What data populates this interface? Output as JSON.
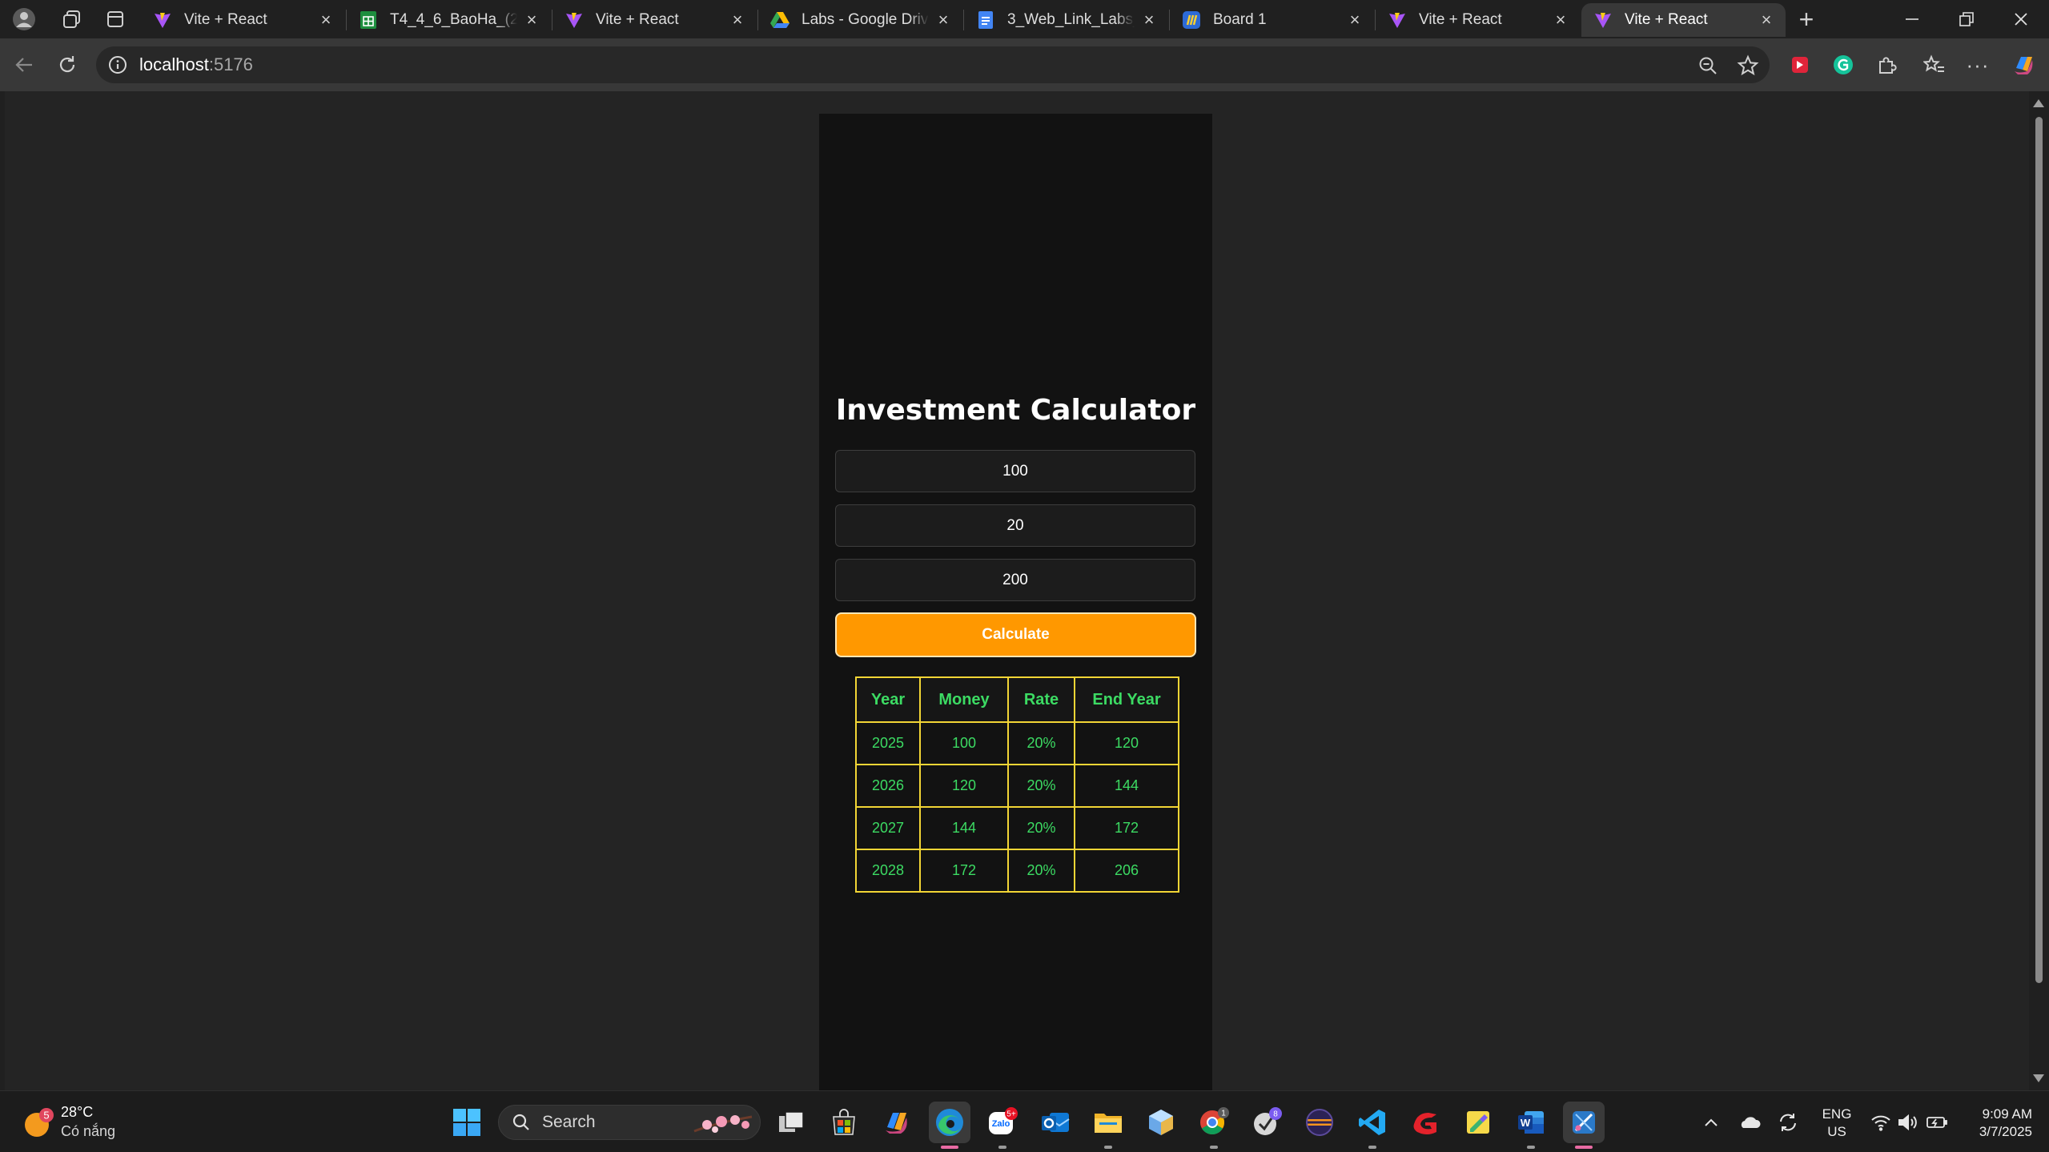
{
  "browser": {
    "tabs": [
      {
        "title": "Vite + React",
        "icon": "vite-icon"
      },
      {
        "title": "T4_4_6_BaoHa_(2Nh",
        "icon": "sheets-icon"
      },
      {
        "title": "Vite + React",
        "icon": "vite-icon"
      },
      {
        "title": "Labs - Google Drive",
        "icon": "drive-icon"
      },
      {
        "title": "3_Web_Link_Labs_Re",
        "icon": "docs-icon"
      },
      {
        "title": "Board 1",
        "icon": "miro-icon"
      },
      {
        "title": "Vite + React",
        "icon": "vite-icon"
      },
      {
        "title": "Vite + React",
        "icon": "vite-icon",
        "active": true
      }
    ],
    "address": {
      "host": "localhost",
      "port": ":5176"
    }
  },
  "app": {
    "title": "Investment Calculator",
    "inputs": [
      {
        "value": "100"
      },
      {
        "value": "20"
      },
      {
        "value": "200"
      }
    ],
    "button_label": "Calculate",
    "table": {
      "headers": [
        "Year",
        "Money",
        "Rate",
        "End Year"
      ],
      "rows": [
        [
          "2025",
          "100",
          "20%",
          "120"
        ],
        [
          "2026",
          "120",
          "20%",
          "144"
        ],
        [
          "2027",
          "144",
          "20%",
          "172"
        ],
        [
          "2028",
          "172",
          "20%",
          "206"
        ]
      ]
    },
    "colors": {
      "accent": "#ff9800",
      "table_text": "#3cdb63",
      "table_border": "#f2d535"
    }
  },
  "taskbar": {
    "weather": {
      "badge": "5",
      "temp": "28°C",
      "desc": "Có nắng"
    },
    "search_label": "Search",
    "badges": {
      "zalo": "5+",
      "chrome": "1",
      "app8": "8"
    },
    "lang": {
      "line1": "ENG",
      "line2": "US"
    },
    "clock": {
      "time": "9:09 AM",
      "date": "3/7/2025"
    }
  }
}
